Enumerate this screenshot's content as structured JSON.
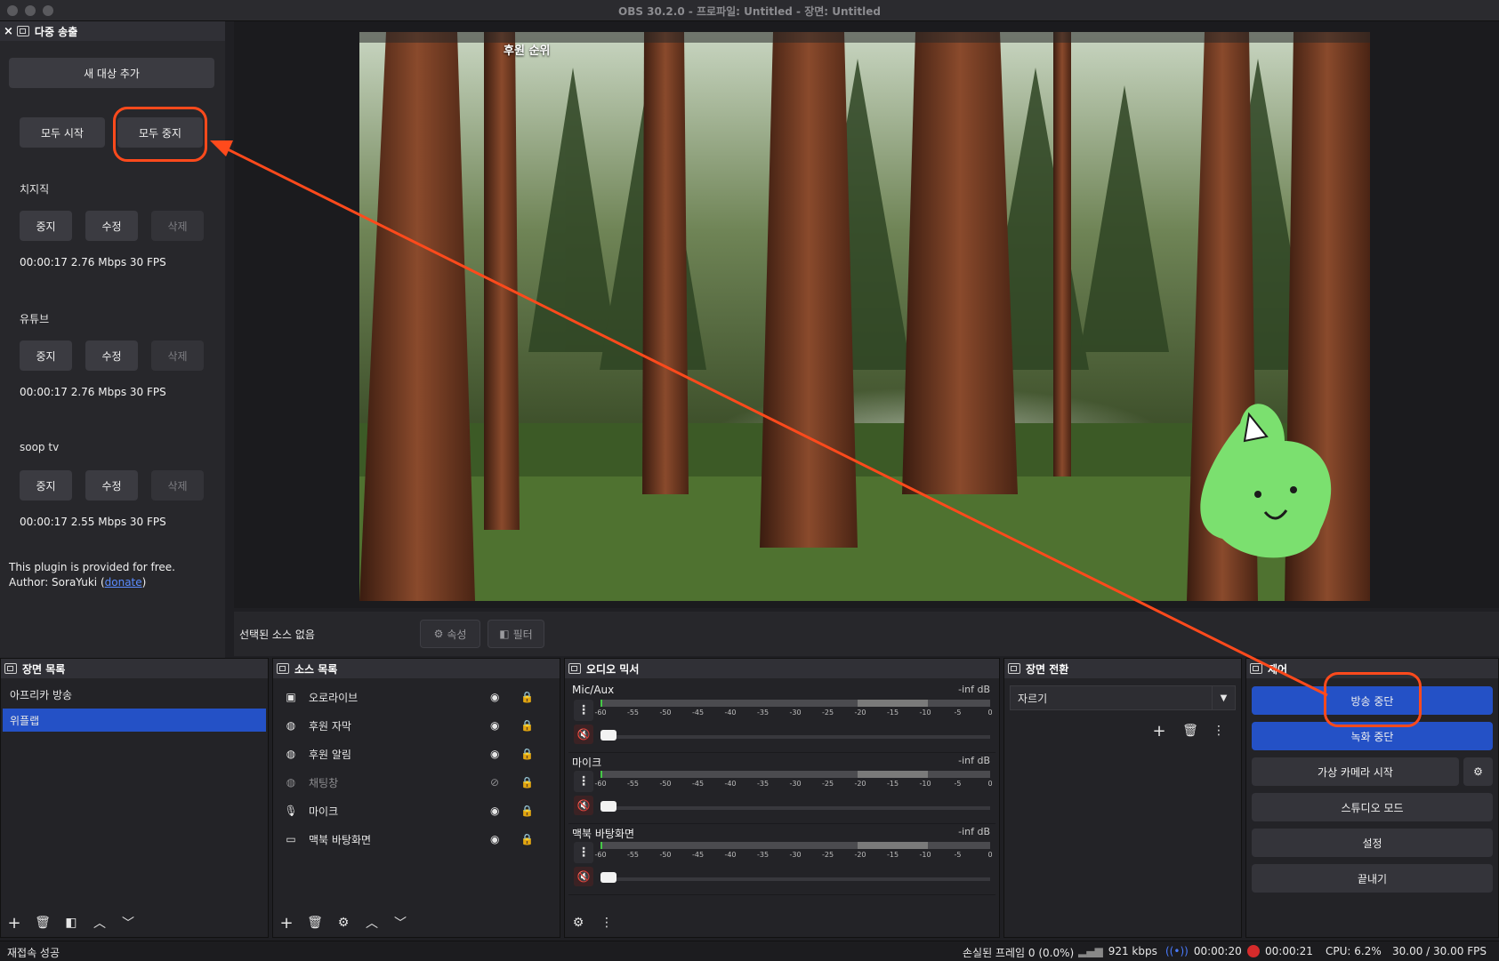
{
  "window": {
    "title": "OBS 30.2.0 - 프로파일: Untitled - 장면: Untitled"
  },
  "multi_output": {
    "title": "다중 송출",
    "close_glyph": "×",
    "add_target": "새 대상 추가",
    "start_all": "모두 시작",
    "stop_all": "모두 중지",
    "targets": [
      {
        "name": "치지직",
        "stop": "중지",
        "edit": "수정",
        "delete": "삭제",
        "stats": "00:00:17  2.76 Mbps  30 FPS"
      },
      {
        "name": "유튜브",
        "stop": "중지",
        "edit": "수정",
        "delete": "삭제",
        "stats": "00:00:17  2.76 Mbps  30 FPS"
      },
      {
        "name": "soop tv",
        "stop": "중지",
        "edit": "수정",
        "delete": "삭제",
        "stats": "00:00:17  2.55 Mbps  30 FPS"
      }
    ],
    "note_line1": "This plugin is provided for free.",
    "note_line2_prefix": "Author: SoraYuki (",
    "note_link": "donate",
    "note_line2_suffix": ")"
  },
  "preview": {
    "overlay_text": "후원 순위"
  },
  "source_bar": {
    "no_source": "선택된 소스 없음",
    "properties": "속성",
    "filters": "필터"
  },
  "scenes": {
    "title": "장면 목록",
    "items": [
      {
        "label": "아프리카 방송",
        "active": false
      },
      {
        "label": "위플랩",
        "active": true
      }
    ]
  },
  "sources": {
    "title": "소스 목록",
    "items": [
      {
        "label": "오로라이브",
        "icon": "image-icon",
        "visible": true
      },
      {
        "label": "후원 자막",
        "icon": "globe-icon",
        "visible": true
      },
      {
        "label": "후원 알림",
        "icon": "globe-icon",
        "visible": true
      },
      {
        "label": "채팅창",
        "icon": "globe-icon",
        "visible": false
      },
      {
        "label": "마이크",
        "icon": "microphone-icon",
        "visible": true
      },
      {
        "label": "맥북 바탕화면",
        "icon": "monitor-icon",
        "visible": true
      }
    ]
  },
  "mixer": {
    "title": "오디오 믹서",
    "scale": [
      "-60",
      "-55",
      "-50",
      "-45",
      "-40",
      "-35",
      "-30",
      "-25",
      "-20",
      "-15",
      "-10",
      "-5",
      "0"
    ],
    "channels": [
      {
        "name": "Mic/Aux",
        "db": "-inf dB"
      },
      {
        "name": "마이크",
        "db": "-inf dB"
      },
      {
        "name": "맥북 바탕화면",
        "db": "-inf dB"
      }
    ]
  },
  "transitions": {
    "title": "장면 전환",
    "selected": "자르기"
  },
  "controls": {
    "title": "제어",
    "stop_stream": "방송 중단",
    "stop_record": "녹화 중단",
    "virtual_cam": "가상 카메라 시작",
    "studio_mode": "스튜디오 모드",
    "settings": "설정",
    "exit": "끝내기"
  },
  "status": {
    "reconnect": "재접속 성공",
    "dropped": "손실된 프레임 0 (0.0%)",
    "bitrate": "921 kbps",
    "stream_time": "00:00:20",
    "rec_time": "00:00:21",
    "cpu": "CPU: 6.2%",
    "fps": "30.00 / 30.00 FPS"
  },
  "colors": {
    "accent": "#2451c6",
    "annotation": "#ff4a1c"
  }
}
